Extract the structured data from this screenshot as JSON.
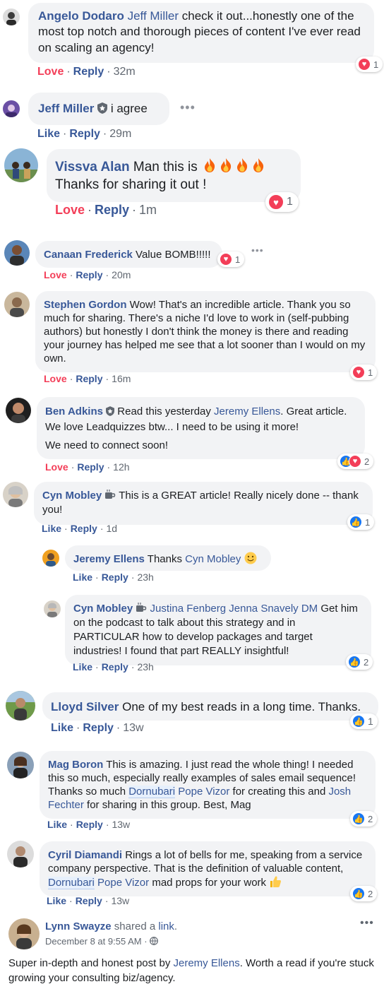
{
  "colors": {
    "link": "#385898",
    "love": "#f33e58",
    "like": "#1877f2",
    "bubble": "#f2f3f5",
    "meta": "#606770"
  },
  "comments": [
    {
      "name": "Angelo Dodaro",
      "mention": "Jeff Miller",
      "text": " check it out...honestly one of the most top notch and thorough pieces of content I've ever read on scaling an agency!",
      "action": "Love",
      "reply": "Reply",
      "time": "32m",
      "reactions": [
        "love"
      ],
      "reaction_count": "1"
    },
    {
      "name": "Jeff Miller",
      "text": " i agree",
      "action": "Like",
      "reply": "Reply",
      "time": "29m"
    },
    {
      "name": "Vissva Alan",
      "text": " Man this is",
      "text2": "Thanks for sharing it out !",
      "action": "Love",
      "reply": "Reply",
      "time": "1m",
      "reactions": [
        "love"
      ],
      "reaction_count": "1"
    },
    {
      "name": "Canaan Frederick",
      "text": " Value BOMB!!!!!",
      "action": "Love",
      "reply": "Reply",
      "time": "20m",
      "reactions": [
        "love"
      ],
      "reaction_count": "1"
    },
    {
      "name": "Stephen Gordon",
      "text": " Wow! That's an incredible article. Thank you so much for sharing. There's a niche I'd love to work in (self-pubbing authors) but honestly I don't think the money is there and reading your journey has helped me see that a lot sooner than I would on my own.",
      "action": "Love",
      "reply": "Reply",
      "time": "16m",
      "reactions": [
        "love"
      ],
      "reaction_count": "1"
    },
    {
      "name": "Ben Adkins",
      "text": " Read this yesterday ",
      "mention": "Jeremy Ellens",
      "text2": ". Great article. We love Leadquizzes btw... I need to be using it more!",
      "text3": "We need to connect soon!",
      "action": "Love",
      "reply": "Reply",
      "time": "12h",
      "reactions": [
        "like",
        "love"
      ],
      "reaction_count": "2"
    },
    {
      "name": "Cyn Mobley",
      "text": " This is a GREAT article! Really nicely done -- thank you!",
      "action": "Like",
      "reply": "Reply",
      "time": "1d",
      "reactions": [
        "like"
      ],
      "reaction_count": "1"
    },
    {
      "name": "Jeremy Ellens",
      "text": " Thanks ",
      "mention": "Cyn Mobley",
      "action": "Like",
      "reply": "Reply",
      "time": "23h"
    },
    {
      "name": "Cyn Mobley",
      "mention": "Justina Fenberg",
      "mention2": "Jenna Snavely DM",
      "text": " Get him on the podcast to talk about this strategy and in PARTICULAR how to develop packages and target industries! I found that part REALLY insightful!",
      "action": "Like",
      "reply": "Reply",
      "time": "23h",
      "reactions": [
        "like"
      ],
      "reaction_count": "2"
    },
    {
      "name": "Lloyd Silver",
      "text": " One of my best reads in a long time. Thanks.",
      "action": "Like",
      "reply": "Reply",
      "time": "13w",
      "reactions": [
        "like"
      ],
      "reaction_count": "1"
    },
    {
      "name": "Mag Boron",
      "text": " This is amazing. I just read the whole thing! I needed this so much, especially really examples of sales email sequence! Thanks so much ",
      "tag1": "Dornubari",
      "tag1b": " Pope Vizor",
      "text2": " for creating this and ",
      "mention": "Josh Fechter",
      "text3": " for sharing in this group. Best, Mag",
      "action": "Like",
      "reply": "Reply",
      "time": "13w",
      "reactions": [
        "like"
      ],
      "reaction_count": "2"
    },
    {
      "name": "Cyril Diamandi",
      "text": " Rings a lot of bells for me, speaking from a service company perspective. That is the definition of valuable content, ",
      "tag1": "Dornubari",
      "tag1b": " Pope Vizor",
      "text2": " mad props for your work ",
      "action": "Like",
      "reply": "Reply",
      "time": "13w",
      "reactions": [
        "like"
      ],
      "reaction_count": "2"
    }
  ],
  "post": {
    "author": "Lynn Swayze",
    "shared": " shared a ",
    "link_word": "link",
    "period": ".",
    "date": "December 8 at 9:55 AM",
    "dot": " · ",
    "body1": "Super in-depth and honest post by ",
    "mention": "Jeremy Ellens",
    "body2": ". Worth a read if you're stuck growing your consulting biz/agency."
  }
}
